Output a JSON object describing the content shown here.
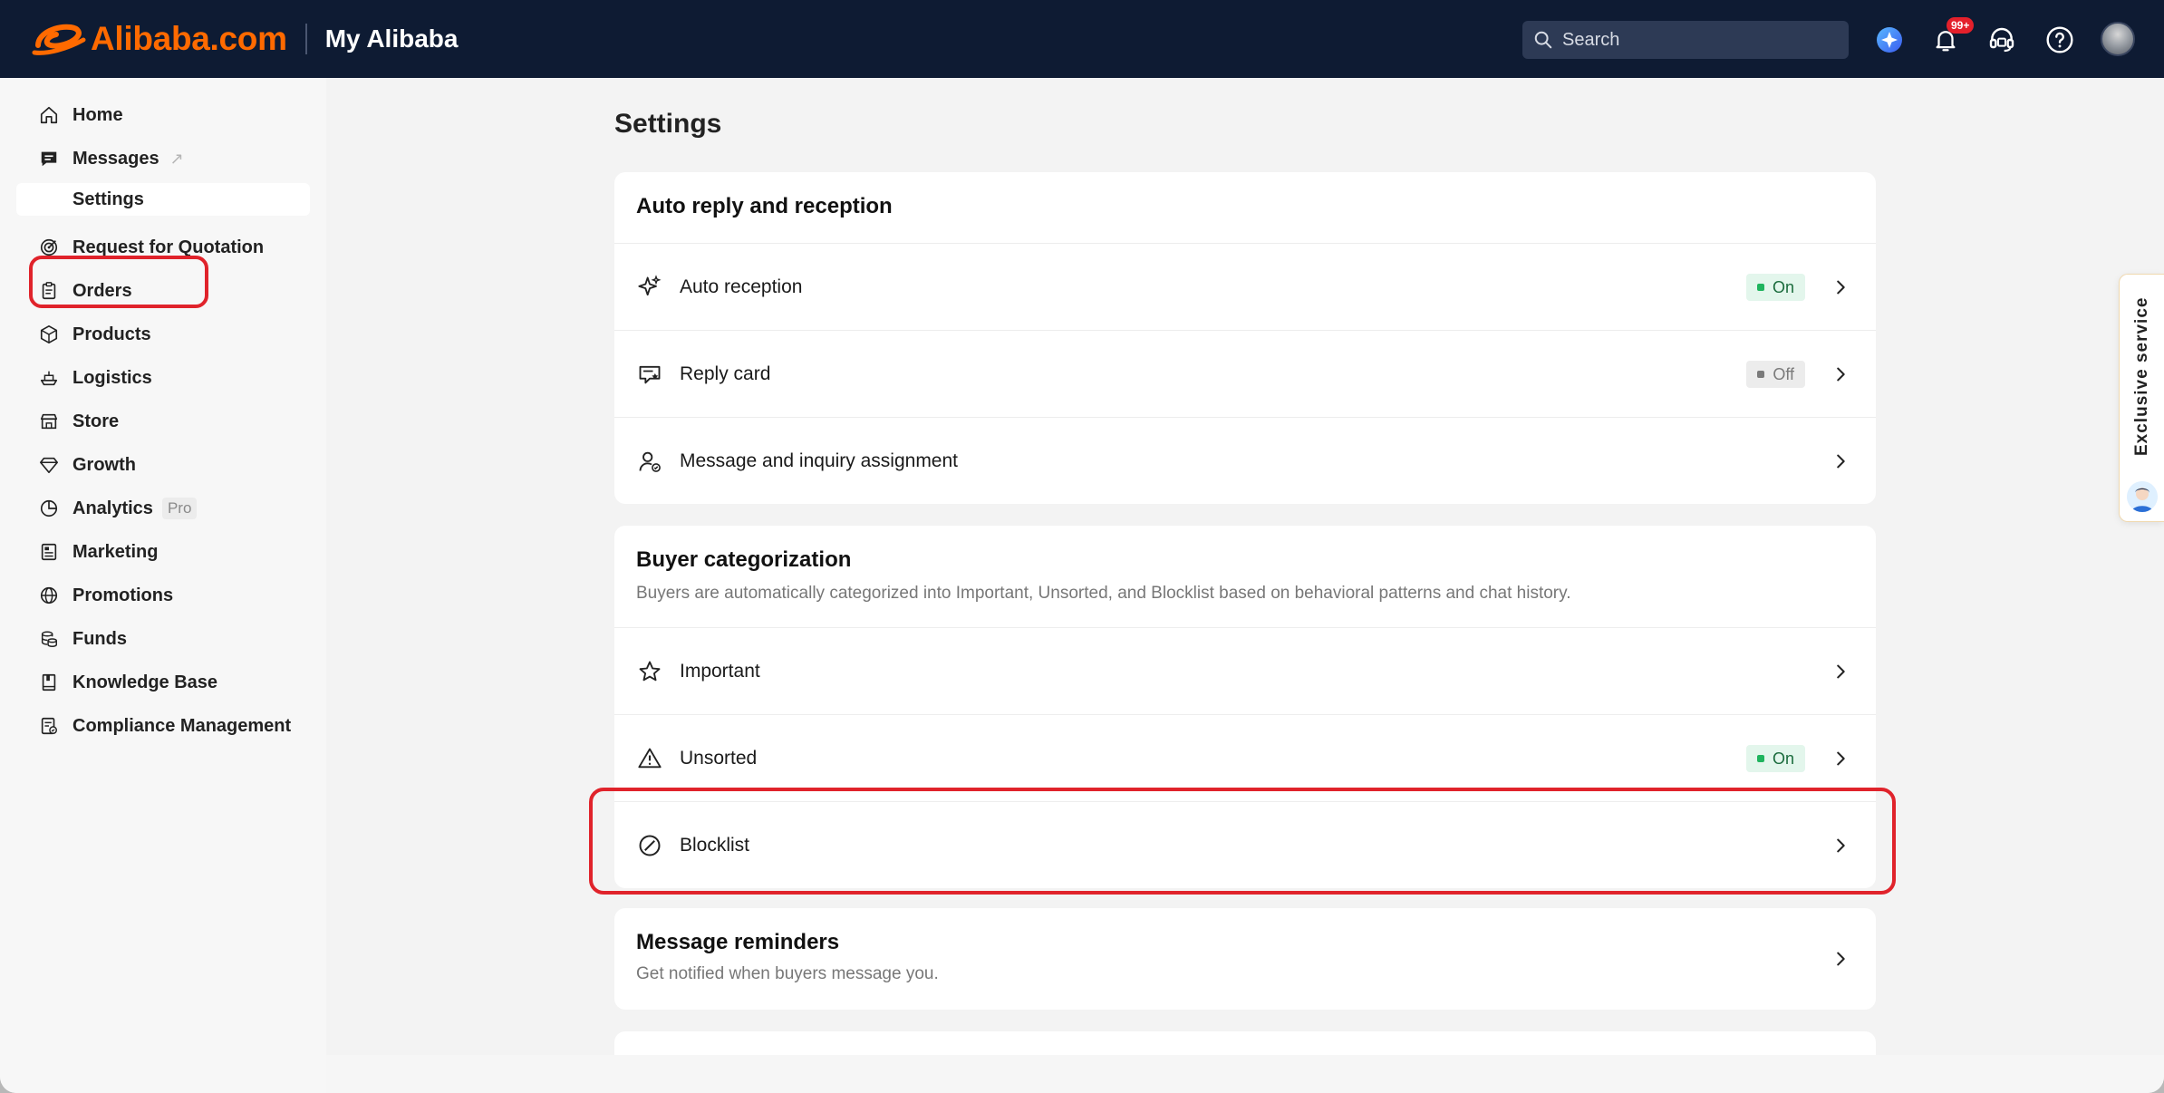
{
  "header": {
    "logo_text": "Alibaba.com",
    "title": "My Alibaba",
    "search_placeholder": "Search",
    "notification_badge": "99+"
  },
  "sidebar": {
    "items": [
      {
        "label": "Home",
        "icon": "home-icon"
      },
      {
        "label": "Messages",
        "icon": "message-icon",
        "external": "↗"
      },
      {
        "label": "Settings",
        "icon": "",
        "active": true
      },
      {
        "label": "Request for Quotation",
        "icon": "target-icon"
      },
      {
        "label": "Orders",
        "icon": "clipboard-icon"
      },
      {
        "label": "Products",
        "icon": "box-icon"
      },
      {
        "label": "Logistics",
        "icon": "ship-icon"
      },
      {
        "label": "Store",
        "icon": "store-icon"
      },
      {
        "label": "Growth",
        "icon": "diamond-icon"
      },
      {
        "label": "Analytics",
        "icon": "pie-chart-icon",
        "tag": "Pro"
      },
      {
        "label": "Marketing",
        "icon": "document-icon"
      },
      {
        "label": "Promotions",
        "icon": "globe-icon"
      },
      {
        "label": "Funds",
        "icon": "coins-icon"
      },
      {
        "label": "Knowledge Base",
        "icon": "book-icon"
      },
      {
        "label": "Compliance Management",
        "icon": "compliance-icon"
      }
    ]
  },
  "main": {
    "page_title": "Settings",
    "auto_reply": {
      "title": "Auto reply and reception",
      "rows": [
        {
          "label": "Auto reception",
          "status": "On"
        },
        {
          "label": "Reply card",
          "status": "Off"
        },
        {
          "label": "Message and inquiry assignment"
        }
      ]
    },
    "buyer_categorization": {
      "title": "Buyer categorization",
      "description": "Buyers are automatically categorized into Important, Unsorted, and Blocklist based on behavioral patterns and chat history.",
      "rows": [
        {
          "label": "Important"
        },
        {
          "label": "Unsorted",
          "status": "On"
        },
        {
          "label": "Blocklist"
        }
      ]
    },
    "message_reminders": {
      "title": "Message reminders",
      "description": "Get notified when buyers message you."
    }
  },
  "exclusive_service": {
    "label": "Exclusive  service"
  },
  "colors": {
    "topbar": "#0e1b33",
    "brand_orange": "#ff6a00",
    "highlight_red": "#e0232b",
    "status_on_bg": "#e3f6ec",
    "status_on_dot": "#1fb45e"
  }
}
